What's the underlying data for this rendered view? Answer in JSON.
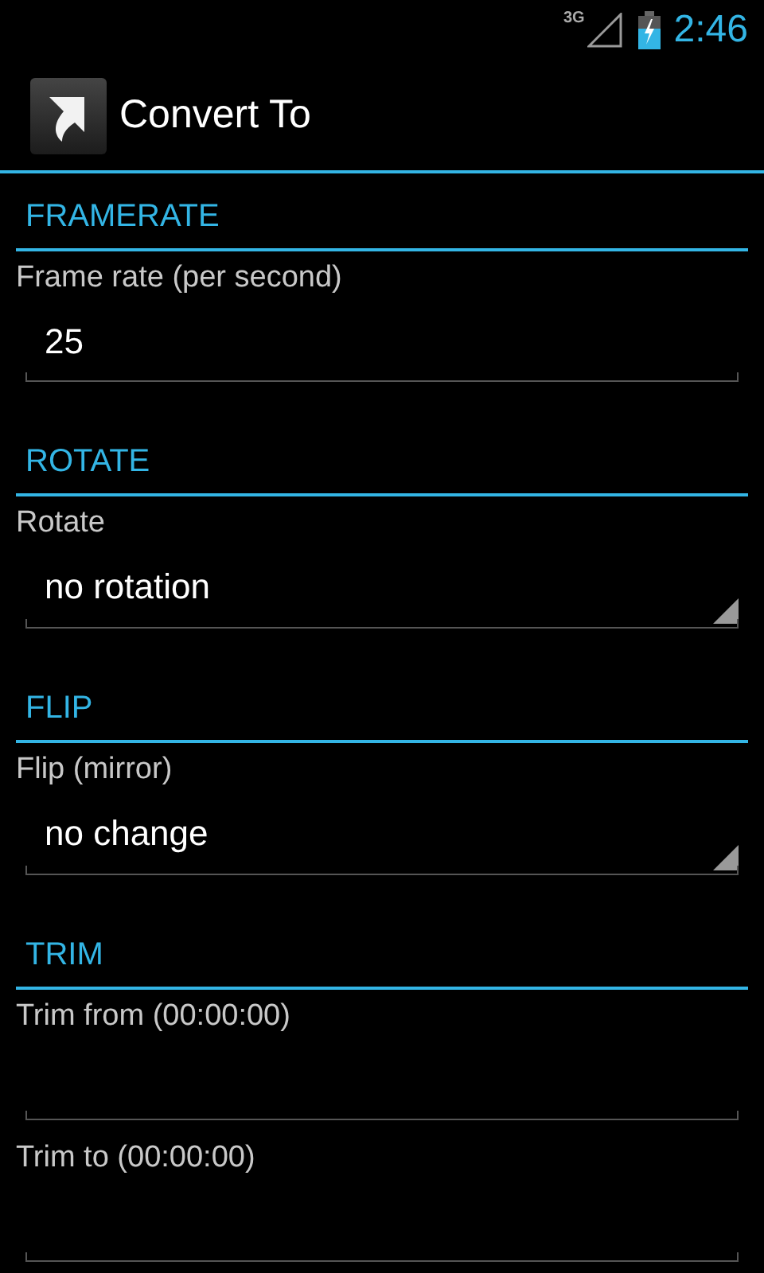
{
  "status_bar": {
    "network": "3G",
    "time": "2:46"
  },
  "action_bar": {
    "title": "Convert To"
  },
  "sections": [
    {
      "title": "FRAMERATE",
      "items": [
        {
          "kind": "text",
          "label": "Frame rate (per second)",
          "value": "25"
        }
      ]
    },
    {
      "title": "ROTATE",
      "items": [
        {
          "kind": "spinner",
          "label": "Rotate",
          "value": "no rotation"
        }
      ]
    },
    {
      "title": "FLIP",
      "items": [
        {
          "kind": "spinner",
          "label": "Flip (mirror)",
          "value": "no change"
        }
      ]
    },
    {
      "title": "TRIM",
      "items": [
        {
          "kind": "text",
          "label": "Trim from (00:00:00)"
        },
        {
          "kind": "text",
          "label": "Trim to (00:00:00)"
        }
      ]
    }
  ]
}
